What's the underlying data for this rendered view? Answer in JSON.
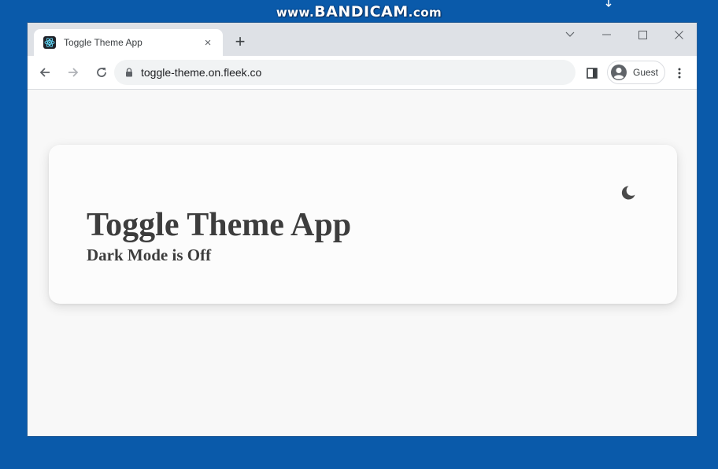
{
  "watermark": {
    "prefix": "www.",
    "brand": "BANDICAM",
    "suffix": ".com"
  },
  "browser": {
    "tab": {
      "title": "Toggle Theme App",
      "favicon": "react-icon",
      "close_label": "×"
    },
    "new_tab_label": "+",
    "window_controls": [
      "tab-search-icon",
      "minimize-icon",
      "maximize-icon",
      "close-icon"
    ],
    "url": "toggle-theme.on.fleek.co",
    "profile": {
      "label": "Guest",
      "icon": "account-circle-icon"
    }
  },
  "app": {
    "title": "Toggle Theme App",
    "status": "Dark Mode is Off",
    "toggle_icon": "moon-icon"
  },
  "colors": {
    "desktop": "#0a5aaa",
    "tab_strip": "#dee1e6",
    "page_background": "#f8f8f8",
    "card_background": "#fcfcfc",
    "text": "#3d3d3d"
  }
}
